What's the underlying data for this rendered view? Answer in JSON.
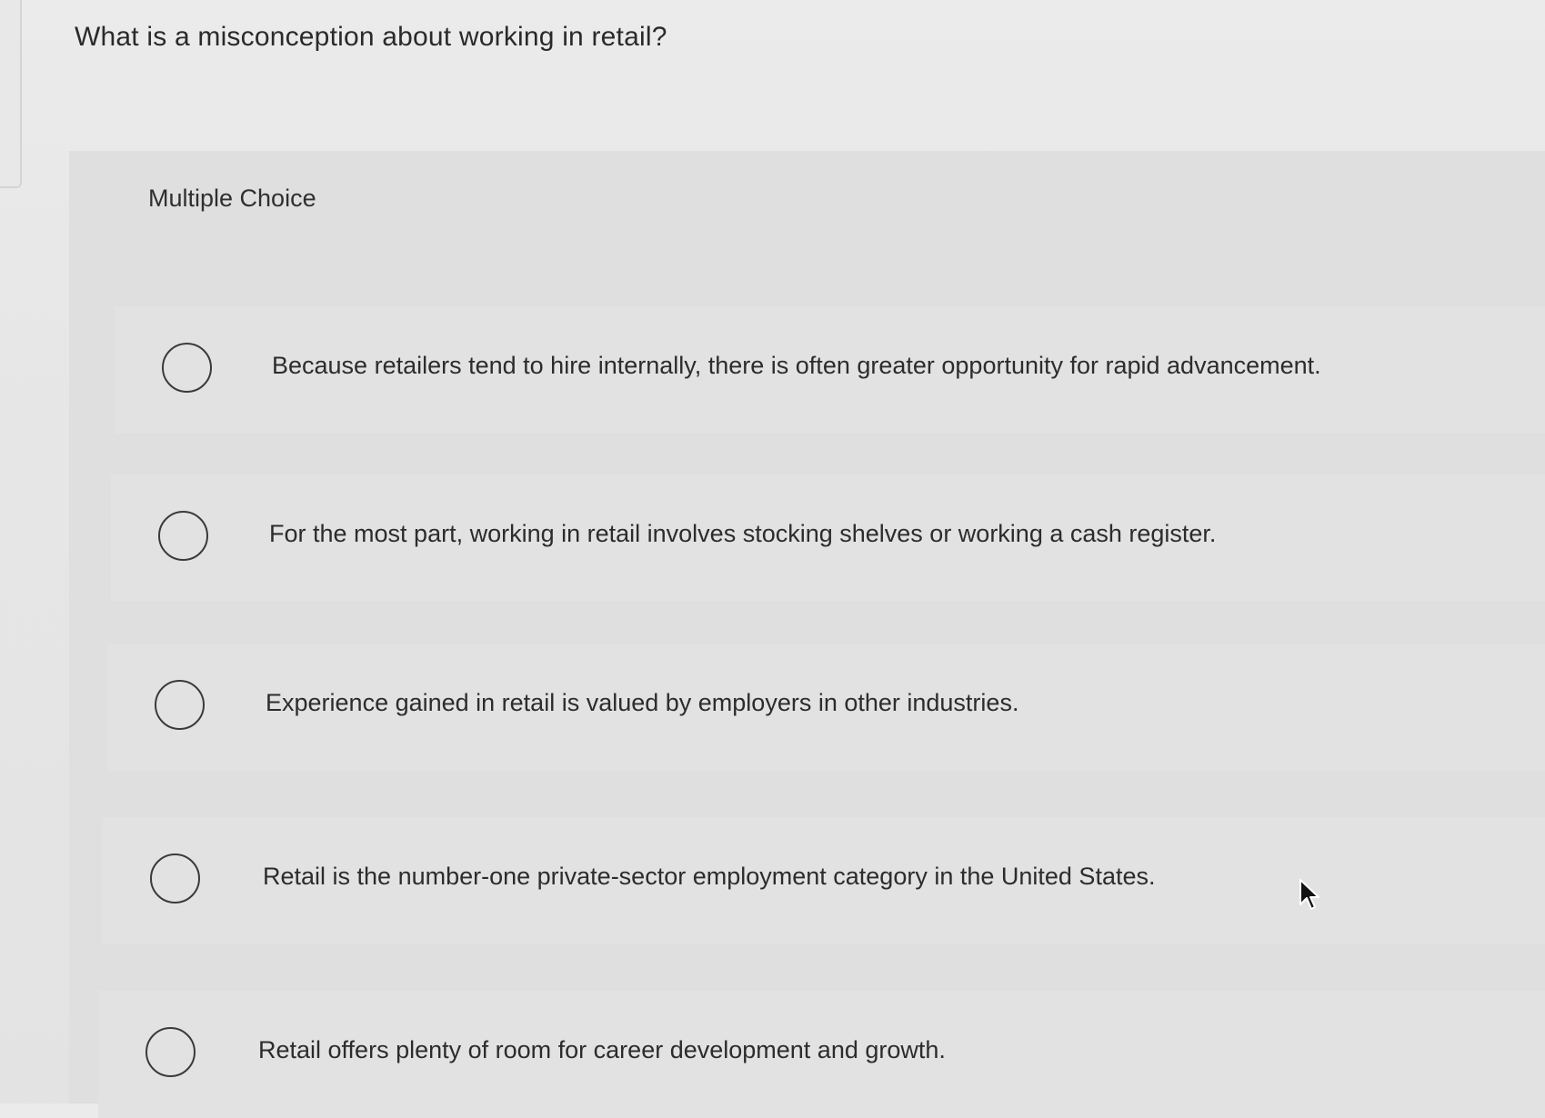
{
  "question": {
    "text": "What is a misconception about working in retail?"
  },
  "question_type": "Multiple Choice",
  "options": [
    {
      "label": "Because retailers tend to hire internally, there is often greater opportunity for rapid advancement.",
      "selected": false
    },
    {
      "label": "For the most part, working in retail involves stocking shelves or working a cash register.",
      "selected": false
    },
    {
      "label": "Experience gained in retail is valued by employers in other industries.",
      "selected": false
    },
    {
      "label": "Retail is the number-one private-sector employment category in the United States.",
      "selected": false
    },
    {
      "label": "Retail offers plenty of room for career development and growth.",
      "selected": false
    }
  ],
  "icons": {
    "radio": "radio-unchecked-icon",
    "cursor": "mouse-pointer-icon"
  },
  "colors": {
    "background": "#e6e6e6",
    "panel": "#dfdfdf",
    "text": "#2d2d2d",
    "radio_border": "#3a3a3a"
  }
}
